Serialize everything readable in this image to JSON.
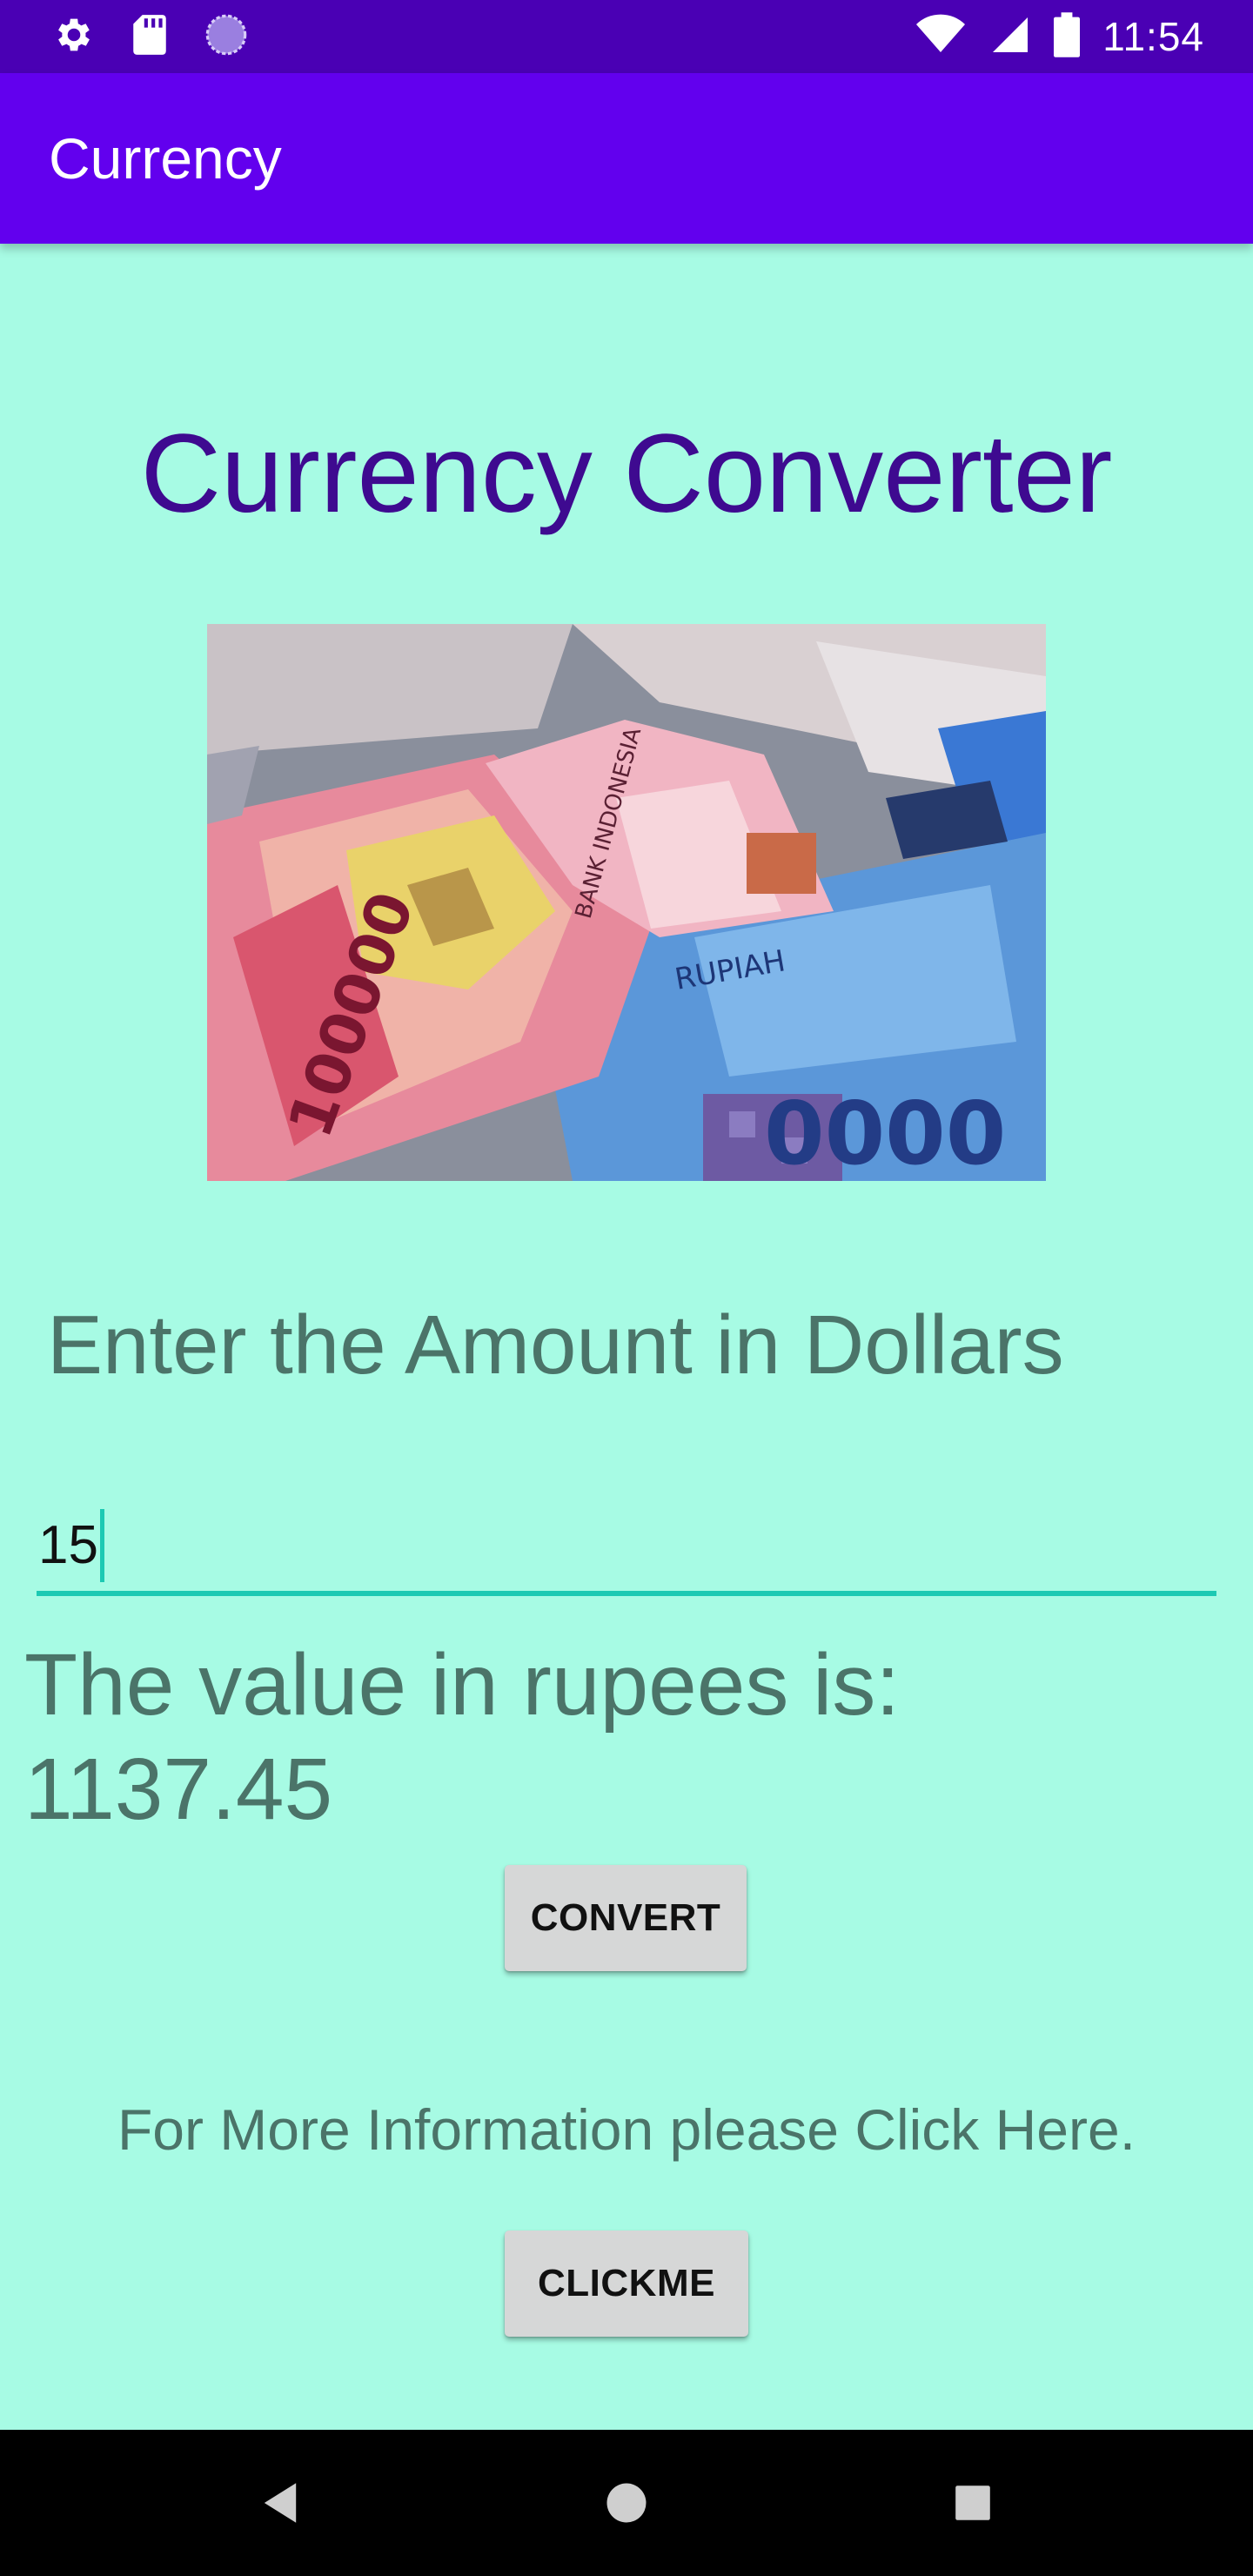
{
  "status_bar": {
    "time": "11:54",
    "left_icons": [
      "gear-icon",
      "sd-card-icon",
      "sync-circle-icon"
    ],
    "right_icons": [
      "wifi-icon",
      "cell-signal-icon",
      "battery-icon"
    ]
  },
  "app_bar": {
    "title": "Currency"
  },
  "main": {
    "heading": "Currency Converter",
    "photo_icon": "banknotes-photo",
    "prompt_label": "Enter the Amount in Dollars",
    "amount_input": {
      "value": "15"
    },
    "result_text": "The value in rupees is: 1137.45",
    "convert_button": "CONVERT",
    "info_text": "For More Information please Click Here.",
    "clickme_button": "CLICKME"
  },
  "nav_bar": {
    "buttons": [
      "back-icon",
      "home-icon",
      "recents-icon"
    ]
  },
  "colors": {
    "status_bar": "#4a00b4",
    "app_bar": "#6200ee",
    "background": "#a7fbe4",
    "heading": "#3e0a90",
    "accent": "#1cc9b3",
    "text": "#4b7469",
    "button": "#d6d7d7"
  }
}
